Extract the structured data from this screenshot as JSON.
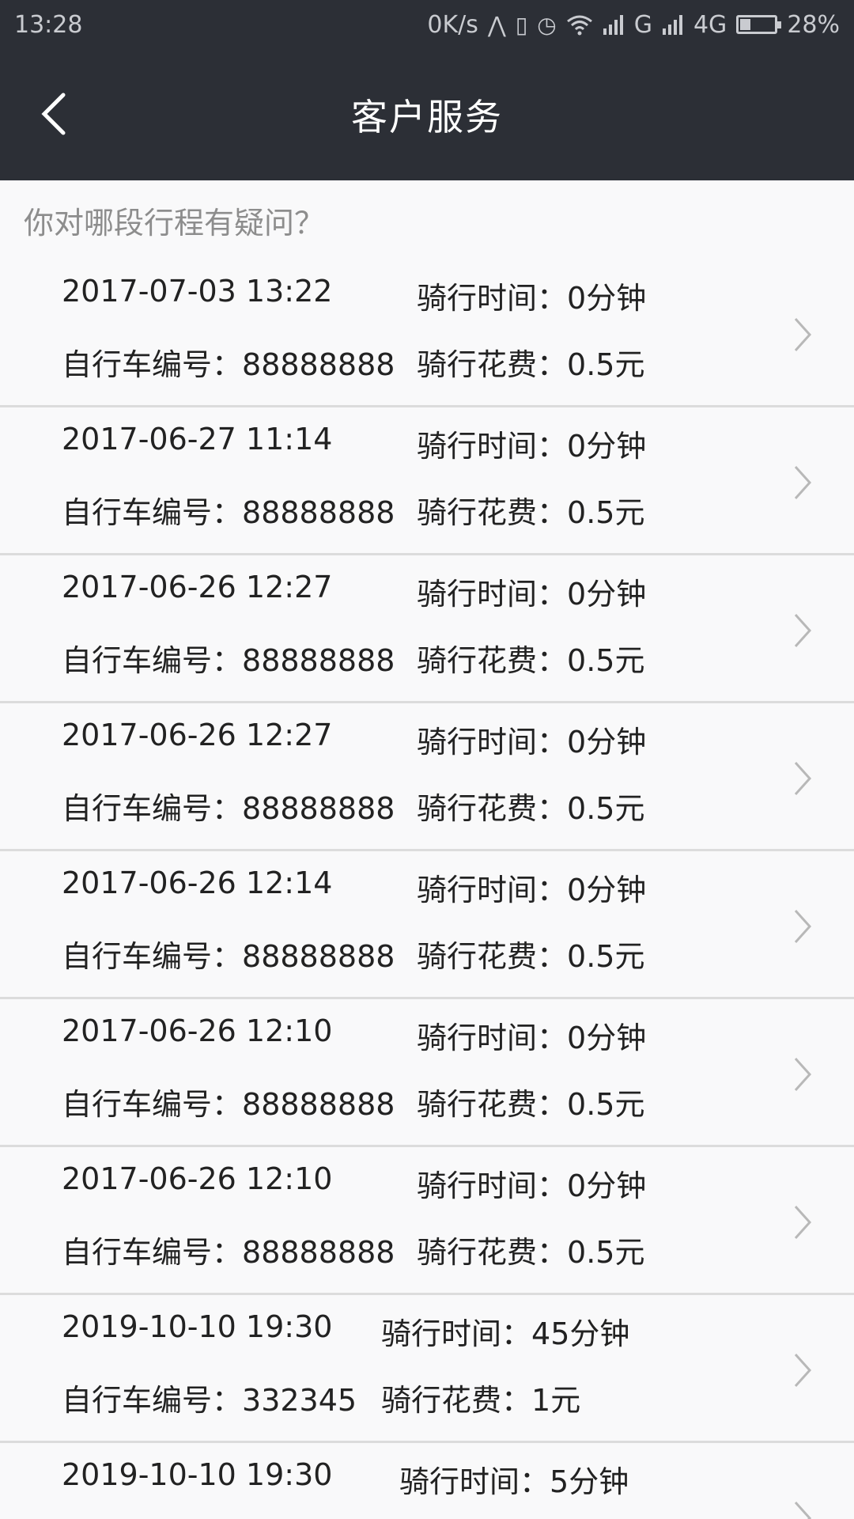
{
  "status_bar": {
    "time": "13:28",
    "net_speed": "0K/s",
    "signal1": "G",
    "signal2": "4G",
    "battery": "28%",
    "battery_level": 0.28,
    "icons": [
      "nav-icon",
      "vibrate-icon",
      "alarm-icon",
      "wifi-icon",
      "signal-icon",
      "battery-icon"
    ]
  },
  "header": {
    "title": "客户服务",
    "back_icon": "chevron-left-icon"
  },
  "prompt": "你对哪段行程有疑问？",
  "labels": {
    "ride_time": "骑行时间：",
    "bike_no": "自行车编号：",
    "ride_cost": "骑行花费："
  },
  "trips": [
    {
      "datetime": "2017-07-03 13:22",
      "duration": "0分钟",
      "bike_no": "88888888",
      "cost": "0.5元"
    },
    {
      "datetime": "2017-06-27 11:14",
      "duration": "0分钟",
      "bike_no": "88888888",
      "cost": "0.5元"
    },
    {
      "datetime": "2017-06-26 12:27",
      "duration": "0分钟",
      "bike_no": "88888888",
      "cost": "0.5元"
    },
    {
      "datetime": "2017-06-26 12:27",
      "duration": "0分钟",
      "bike_no": "88888888",
      "cost": "0.5元"
    },
    {
      "datetime": "2017-06-26 12:14",
      "duration": "0分钟",
      "bike_no": "88888888",
      "cost": "0.5元"
    },
    {
      "datetime": "2017-06-26 12:10",
      "duration": "0分钟",
      "bike_no": "88888888",
      "cost": "0.5元"
    },
    {
      "datetime": "2017-06-26 12:10",
      "duration": "0分钟",
      "bike_no": "88888888",
      "cost": "0.5元"
    },
    {
      "datetime": "2019-10-10 19:30",
      "duration": "45分钟",
      "bike_no": "332345",
      "cost": "1元"
    },
    {
      "datetime": "2019-10-10 19:30",
      "duration": "5分钟",
      "bike_no": "",
      "cost": ""
    }
  ]
}
